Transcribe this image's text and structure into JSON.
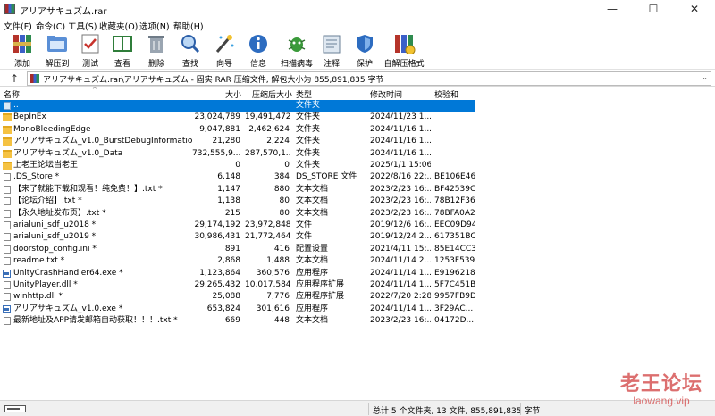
{
  "window": {
    "title": "アリアサキュズム.rar",
    "minimize": "—",
    "maximize": "☐",
    "close": "✕"
  },
  "menu": [
    "文件(F)",
    "命令(C)",
    "工具(S)",
    "收藏夹(O)",
    "选项(N)",
    "帮助(H)"
  ],
  "toolbar": [
    {
      "label": "添加",
      "icon": "add-archive-icon"
    },
    {
      "label": "解压到",
      "icon": "extract-to-icon"
    },
    {
      "label": "测试",
      "icon": "test-icon"
    },
    {
      "label": "查看",
      "icon": "view-icon"
    },
    {
      "label": "删除",
      "icon": "delete-icon"
    },
    {
      "label": "查找",
      "icon": "find-icon"
    },
    {
      "label": "向导",
      "icon": "wizard-icon"
    },
    {
      "label": "信息",
      "icon": "info-icon"
    },
    {
      "label": "扫描病毒",
      "icon": "virus-scan-icon"
    },
    {
      "label": "注释",
      "icon": "comment-icon"
    },
    {
      "label": "保护",
      "icon": "protect-icon"
    },
    {
      "label": "自解压格式",
      "icon": "sfx-icon"
    }
  ],
  "address": {
    "path": "アリアサキュズム.rar\\アリアサキュズム - 固实 RAR 压缩文件, 解包大小为 855,891,835 字节",
    "dropdown": "⌄"
  },
  "columns": {
    "name": "名称",
    "size": "大小",
    "packed": "压缩后大小",
    "type": "类型",
    "modified": "修改时间",
    "crc": "校验和"
  },
  "files": [
    {
      "name": "..",
      "size": "",
      "packed": "",
      "type": "文件夹",
      "modified": "",
      "crc": "",
      "icon": "up",
      "selected": true
    },
    {
      "name": "BepInEx",
      "size": "23,024,789",
      "packed": "19,491,472",
      "type": "文件夹",
      "modified": "2024/11/23 1...",
      "crc": "",
      "icon": "folder"
    },
    {
      "name": "MonoBleedingEdge",
      "size": "9,047,881",
      "packed": "2,462,624",
      "type": "文件夹",
      "modified": "2024/11/16 1...",
      "crc": "",
      "icon": "folder"
    },
    {
      "name": "アリアサキュズム_v1.0_BurstDebugInformation_...",
      "size": "21,280",
      "packed": "2,224",
      "type": "文件夹",
      "modified": "2024/11/16 1...",
      "crc": "",
      "icon": "folder"
    },
    {
      "name": "アリアサキュズム_v1.0_Data",
      "size": "732,555,9...",
      "packed": "287,570,1...",
      "type": "文件夹",
      "modified": "2024/11/16 1...",
      "crc": "",
      "icon": "folder"
    },
    {
      "name": "上老王论坛当老王",
      "size": "0",
      "packed": "0",
      "type": "文件夹",
      "modified": "2025/1/1 15:06",
      "crc": "",
      "icon": "folder"
    },
    {
      "name": ".DS_Store *",
      "size": "6,148",
      "packed": "384",
      "type": "DS_STORE 文件",
      "modified": "2022/8/16 22:...",
      "crc": "BE106E46",
      "icon": "doc"
    },
    {
      "name": "【来了就能下载和观看！纯免费！】.txt *",
      "size": "1,147",
      "packed": "880",
      "type": "文本文档",
      "modified": "2023/2/23 16:...",
      "crc": "BF42539C",
      "icon": "doc"
    },
    {
      "name": "【论坛介绍】.txt *",
      "size": "1,138",
      "packed": "80",
      "type": "文本文档",
      "modified": "2023/2/23 16:...",
      "crc": "78B12F36",
      "icon": "doc"
    },
    {
      "name": "【永久地址发布页】.txt *",
      "size": "215",
      "packed": "80",
      "type": "文本文档",
      "modified": "2023/2/23 16:...",
      "crc": "78BFA0A2",
      "icon": "doc"
    },
    {
      "name": "arialuni_sdf_u2018 *",
      "size": "29,174,192",
      "packed": "23,972,848",
      "type": "文件",
      "modified": "2019/12/6 16:...",
      "crc": "EEC09D94",
      "icon": "doc"
    },
    {
      "name": "arialuni_sdf_u2019 *",
      "size": "30,986,431",
      "packed": "21,772,464",
      "type": "文件",
      "modified": "2019/12/24 2...",
      "crc": "617351BC",
      "icon": "doc"
    },
    {
      "name": "doorstop_config.ini *",
      "size": "891",
      "packed": "416",
      "type": "配置设置",
      "modified": "2021/4/11 15:...",
      "crc": "85E14CC3",
      "icon": "doc"
    },
    {
      "name": "readme.txt *",
      "size": "2,868",
      "packed": "1,488",
      "type": "文本文档",
      "modified": "2024/11/14 2...",
      "crc": "1253F539",
      "icon": "doc"
    },
    {
      "name": "UnityCrashHandler64.exe *",
      "size": "1,123,864",
      "packed": "360,576",
      "type": "应用程序",
      "modified": "2024/11/14 1...",
      "crc": "E9196218",
      "icon": "exe"
    },
    {
      "name": "UnityPlayer.dll *",
      "size": "29,265,432",
      "packed": "10,017,584",
      "type": "应用程序扩展",
      "modified": "2024/11/14 1...",
      "crc": "5F7C451B",
      "icon": "doc"
    },
    {
      "name": "winhttp.dll *",
      "size": "25,088",
      "packed": "7,776",
      "type": "应用程序扩展",
      "modified": "2022/7/20 2:28",
      "crc": "9957FB9D",
      "icon": "doc"
    },
    {
      "name": "アリアサキュズム_v1.0.exe *",
      "size": "653,824",
      "packed": "301,616",
      "type": "应用程序",
      "modified": "2024/11/14 1...",
      "crc": "3F29AC...",
      "icon": "exe"
    },
    {
      "name": "最新地址及APP请发邮箱自动获取！！！.txt *",
      "size": "669",
      "packed": "448",
      "type": "文本文档",
      "modified": "2023/2/23 16:...",
      "crc": "04172D...",
      "icon": "doc"
    }
  ],
  "status": {
    "summary": "总计 5 个文件夹, 13 文件, 855,891,835 字节"
  },
  "watermark": {
    "title": "老王论坛",
    "subtitle": "laowang.vip"
  },
  "colors": {
    "selection": "#0078d7",
    "watermark": "#d65656"
  }
}
